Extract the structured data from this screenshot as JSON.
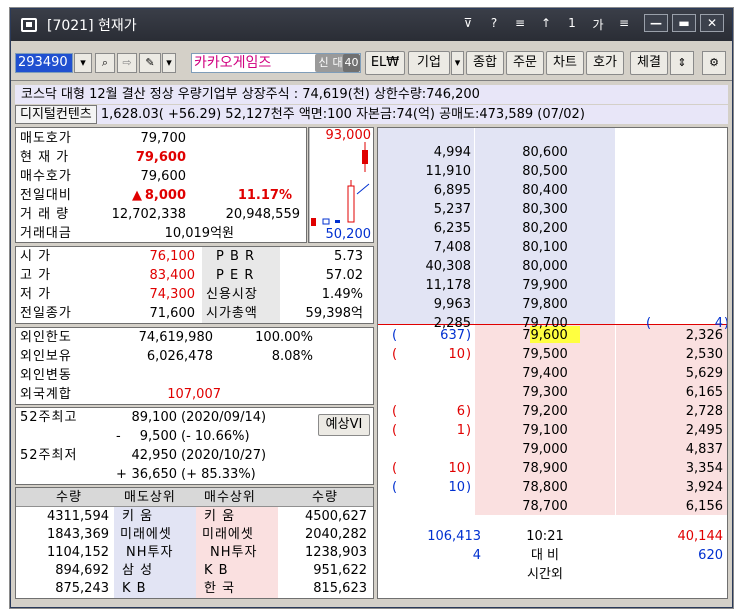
{
  "window": {
    "title": "[7021] 현재가",
    "tools": [
      "⊽",
      "?",
      "≡",
      "↑",
      "1",
      "가",
      "≡"
    ],
    "controls": {
      "minimize": "—",
      "maximize": "▬",
      "close": "✕"
    }
  },
  "toolbar": {
    "code": "293490",
    "stock_name": "카카오게임즈",
    "tags": [
      "신",
      "대",
      "40"
    ],
    "buttons": [
      "EL₩",
      "기업",
      "종합",
      "주문",
      "차트",
      "호가",
      "체결"
    ]
  },
  "info": {
    "line1": "코스닥 대형 12월 결산  정상      우량기업부 상장주식 : 74,619(천) 상한수량:746,200",
    "sector": "디지털컨텐츠",
    "line2": " 1,628.03( +56.29) 52,127천주 액면:100 자본금:74(억) 공매도:473,589 (07/02)"
  },
  "price": {
    "rows": [
      {
        "label": "매도호가",
        "value": "79,700",
        "extra": ""
      },
      {
        "label": "현 재 가",
        "value": "79,600",
        "extra": ""
      },
      {
        "label": "매수호가",
        "value": "79,600",
        "extra": ""
      },
      {
        "label": "전일대비",
        "arrow": "▲",
        "value": "8,000",
        "extra": "11.17%"
      },
      {
        "label": "거 래 량",
        "value": "12,702,338",
        "extra": "20,948,559"
      },
      {
        "label": "거래대금",
        "value": "10,019억원",
        "extra": ""
      }
    ]
  },
  "mini_chart": {
    "high": "93,000",
    "low": "50,200"
  },
  "stats": {
    "rows": [
      {
        "label": "시   가",
        "value": "76,100",
        "label2": "P B R",
        "value2": "5.73"
      },
      {
        "label": "고   가",
        "value": "83,400",
        "label2": "P E R",
        "value2": "57.02"
      },
      {
        "label": "저   가",
        "value": "74,300",
        "label2": "신용시장",
        "value2": "1.49%"
      },
      {
        "label": "전일종가",
        "value": "71,600",
        "label2": "시가총액",
        "value2": "59,398억"
      }
    ]
  },
  "foreign": {
    "rows": [
      {
        "label": "외인한도",
        "value": "74,619,980",
        "extra": "100.00%"
      },
      {
        "label": "외인보유",
        "value": "6,026,478",
        "extra": "8.08%"
      },
      {
        "label": "외인변동",
        "value": "",
        "extra": ""
      },
      {
        "label": "외국계합",
        "value": "107,007",
        "extra": ""
      }
    ]
  },
  "week52": {
    "high_label": "52주최고",
    "high_value": "89,100",
    "high_date": "(2020/09/14)",
    "high_sign": "-",
    "high_diff": "9,500",
    "high_pct": "(-   10.66%)",
    "low_label": "52주최저",
    "low_value": "42,950",
    "low_date": "(2020/10/27)",
    "low_sign": "+",
    "low_diff": "36,650",
    "low_pct": "(+   85.33%)",
    "forecast_button": "예상VI"
  },
  "brokers": {
    "headers": [
      "수량",
      "매도상위",
      "매수상위",
      "수량"
    ],
    "rows": [
      {
        "sell_qty": "4311,594",
        "sell_name": "키    움",
        "buy_name": "키    움",
        "buy_qty": "4500,627"
      },
      {
        "sell_qty": "1843,369",
        "sell_name": "미래에셋",
        "buy_name": "미래에셋",
        "buy_qty": "2040,282"
      },
      {
        "sell_qty": "1104,152",
        "sell_name": "NH투자",
        "buy_name": "NH투자",
        "buy_qty": "1238,903"
      },
      {
        "sell_qty": "894,692",
        "sell_name": "삼    성",
        "buy_name": "K      B",
        "buy_qty": "951,622"
      },
      {
        "sell_qty": "875,243",
        "sell_name": "K      B",
        "buy_name": "한    국",
        "buy_qty": "815,623"
      }
    ]
  },
  "orderbook": {
    "asks": [
      {
        "qty": "4,994",
        "price": "80,600"
      },
      {
        "qty": "11,910",
        "price": "80,500"
      },
      {
        "qty": "6,895",
        "price": "80,400"
      },
      {
        "qty": "5,237",
        "price": "80,300"
      },
      {
        "qty": "6,235",
        "price": "80,200"
      },
      {
        "qty": "7,408",
        "price": "80,100"
      },
      {
        "qty": "40,308",
        "price": "80,000"
      },
      {
        "qty": "11,178",
        "price": "79,900"
      },
      {
        "qty": "9,963",
        "price": "79,800"
      },
      {
        "qty": "2,285",
        "price": "79,700",
        "change": "4"
      }
    ],
    "bids": [
      {
        "price": "79,600",
        "qty": "2,326",
        "change": "637"
      },
      {
        "price": "79,500",
        "qty": "2,530",
        "change": "10"
      },
      {
        "price": "79,400",
        "qty": "5,629",
        "change": ""
      },
      {
        "price": "79,300",
        "qty": "6,165",
        "change": ""
      },
      {
        "price": "79,200",
        "qty": "2,728",
        "change": "6"
      },
      {
        "price": "79,100",
        "qty": "2,495",
        "change": "1"
      },
      {
        "price": "79,000",
        "qty": "4,837",
        "change": ""
      },
      {
        "price": "78,900",
        "qty": "3,354",
        "change": "10"
      },
      {
        "price": "78,800",
        "qty": "3,924",
        "change": "10"
      },
      {
        "price": "78,700",
        "qty": "6,156",
        "change": ""
      }
    ],
    "total_ask_qty": "106,413",
    "time": "10:21",
    "total_bid_qty": "40,144",
    "ask_diff": "4",
    "diff_label": "대  비",
    "bid_diff": "620",
    "after_hours": "시간외"
  },
  "colors": {
    "ask_bg": "#e2e4f4",
    "bid_bg": "#fae0e0",
    "up": "#e00000",
    "down": "#0030d0",
    "highlight": "#ffff40"
  }
}
